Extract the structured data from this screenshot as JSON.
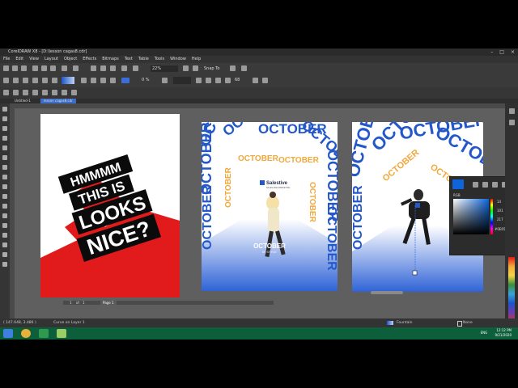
{
  "window": {
    "title": "CorelDRAW X8 - [D:\\lesson cagas8.cdr]",
    "controls": [
      "–",
      "□",
      "×"
    ]
  },
  "menu": [
    "File",
    "Edit",
    "View",
    "Layout",
    "Object",
    "Effects",
    "Bitmaps",
    "Text",
    "Table",
    "Tools",
    "Window",
    "Help"
  ],
  "toolbar": {
    "zoom": "22%",
    "snap_to": "Snap To",
    "opacity": "0 %",
    "size": "68"
  },
  "tabs": [
    {
      "label": "Untitled-1",
      "active": false
    },
    {
      "label": "lesson cagas8.cdr",
      "active": true
    }
  ],
  "page1": {
    "lines": [
      "HMMMM",
      "THIS IS",
      "LOOKS",
      "NICE?"
    ],
    "colors": {
      "red": "#e11b1b",
      "black": "#0b0b0b"
    }
  },
  "page2": {
    "repeat_word": "OCTOBER",
    "brand": "Salestive",
    "brand_sub": "SALES AND MARKETING",
    "headline": "OCTOBER",
    "subheadline": "IN STYLE",
    "colors": {
      "blue": "#2458c9",
      "orange": "#f2a83a"
    }
  },
  "page3": {
    "repeat_word": "OCTOBER",
    "colors": {
      "blue": "#2458c9",
      "orange": "#f2a83a"
    }
  },
  "color_docker": {
    "model": "RGB",
    "values": [
      "14",
      "101",
      "217"
    ],
    "hex": "#0E65D9",
    "swatch": "#0e65d9"
  },
  "page_nav": {
    "current": "1",
    "of_label": "of",
    "total": "1",
    "page_tab": "Page 1"
  },
  "status": {
    "coords": "( 147.648, 3.486 )",
    "object": "Curve on Layer 1",
    "fill": "Fountain",
    "outline": "None"
  },
  "taskbar": {
    "lang": "ENG",
    "time": "12:12 PM",
    "date": "9/21/2020"
  },
  "palette_colors": [
    "#000000",
    "#ffffff",
    "#e11b1b",
    "#f2a83a",
    "#1e55c8",
    "#6a3cb0",
    "#3aa3d8",
    "#9bd3f0",
    "#ff6a00",
    "#bfbfbf",
    "#f5d44a",
    "#3c8f3c",
    "#c23a3a",
    "#7a7a7a",
    "#1e1e1e"
  ]
}
